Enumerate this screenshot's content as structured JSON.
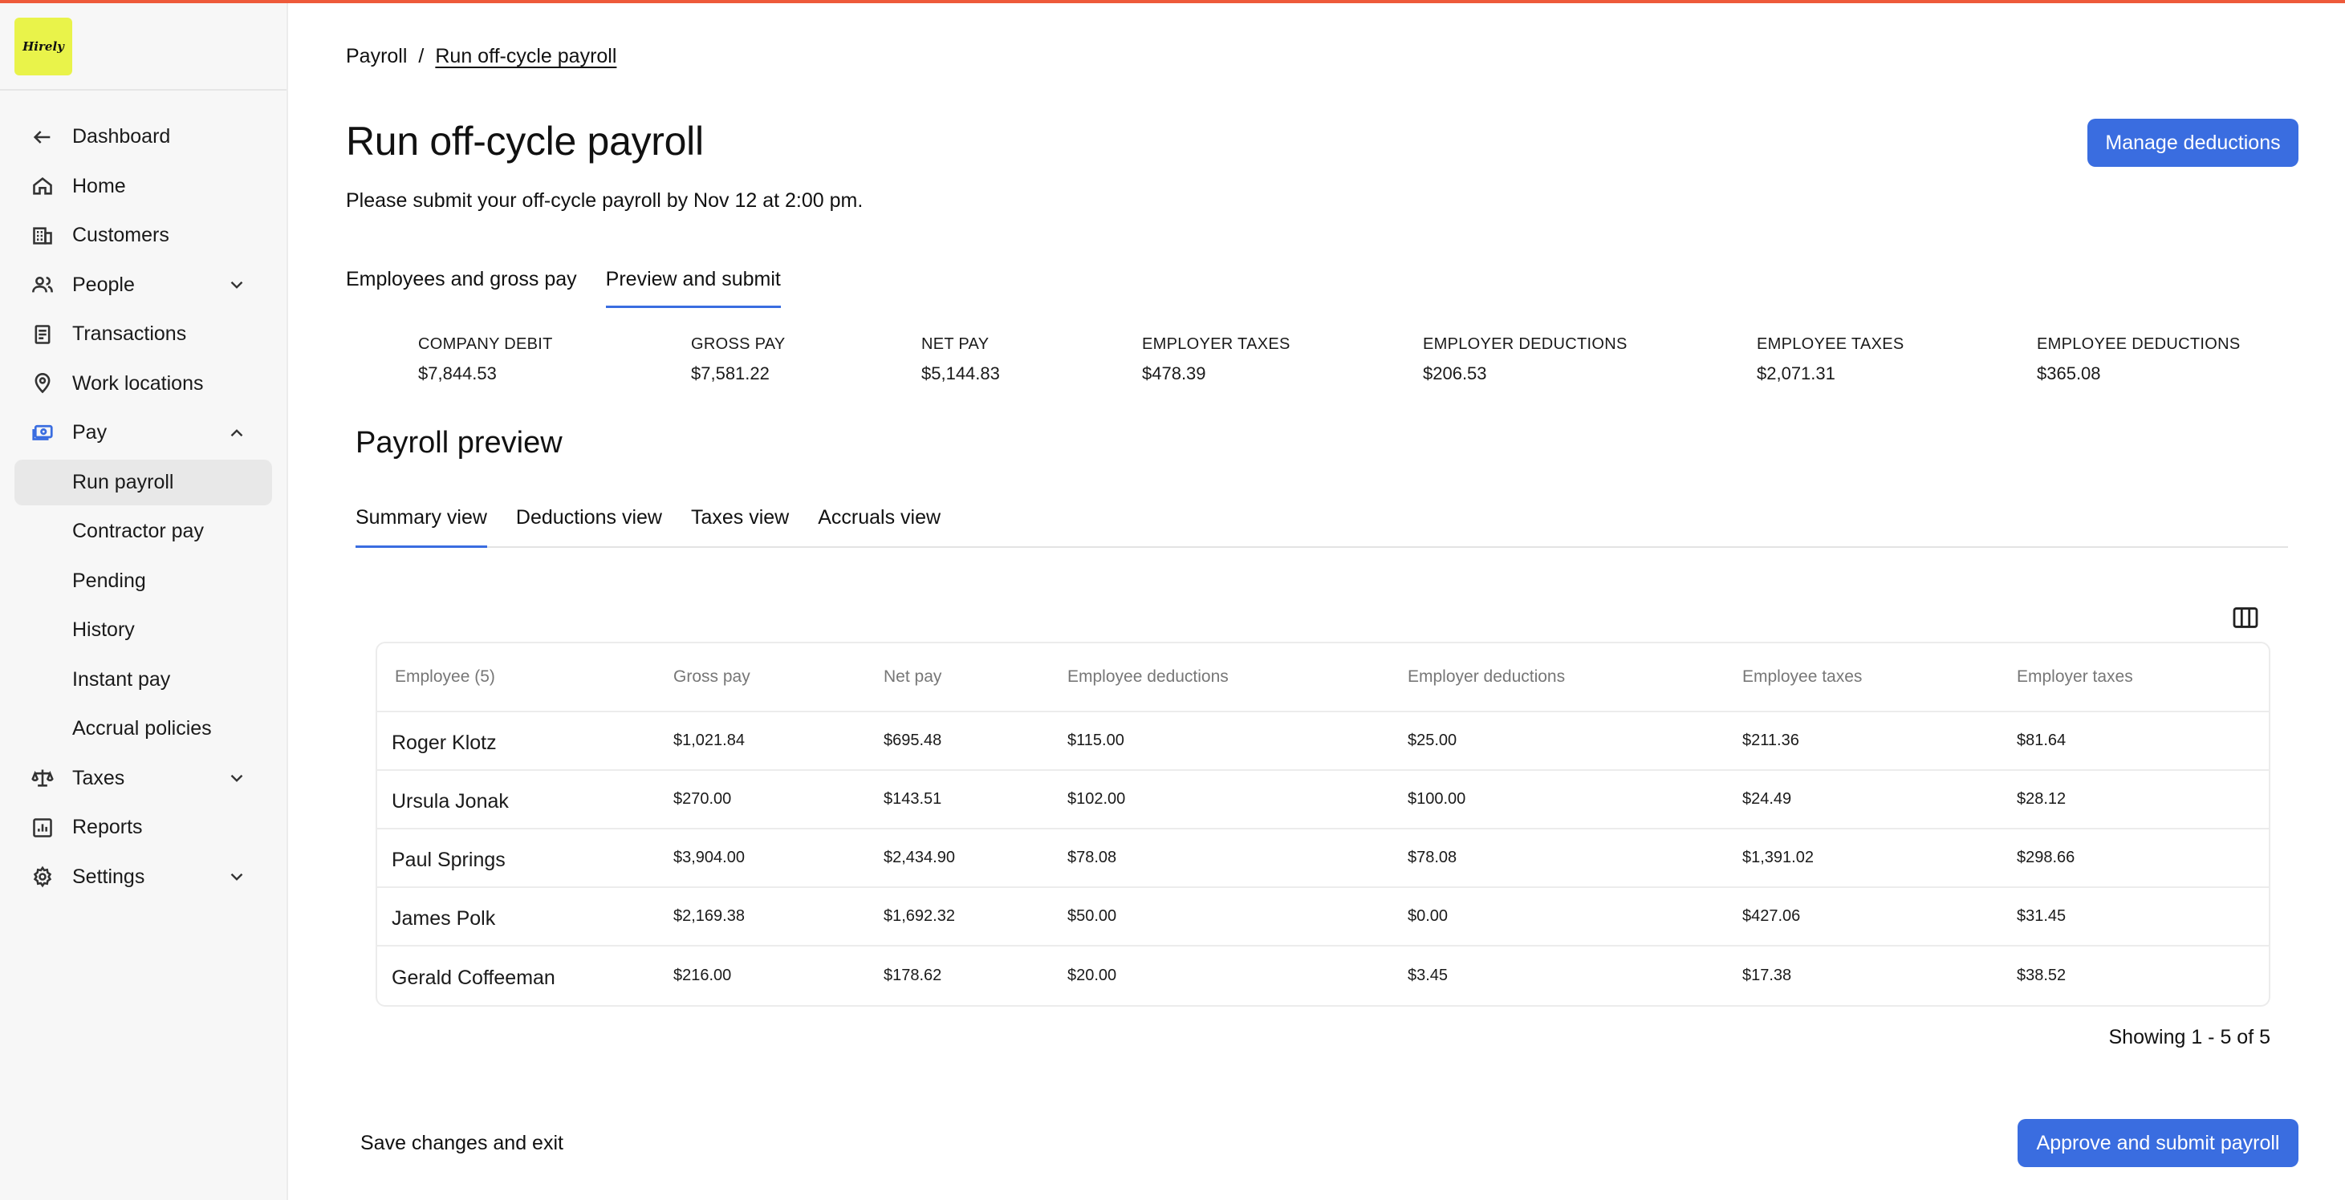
{
  "brand": {
    "logo_text": "Hirely",
    "accent": "#ee5a3a",
    "logo_bg": "#e9f34a",
    "primary": "#3a6de0"
  },
  "sidebar": {
    "items": [
      {
        "label": "Dashboard",
        "icon": "arrow-left-icon"
      },
      {
        "label": "Home",
        "icon": "home-icon"
      },
      {
        "label": "Customers",
        "icon": "building-icon"
      },
      {
        "label": "People",
        "icon": "people-icon",
        "expandable": true
      },
      {
        "label": "Transactions",
        "icon": "receipt-icon"
      },
      {
        "label": "Work locations",
        "icon": "map-pin-icon"
      },
      {
        "label": "Pay",
        "icon": "money-icon",
        "expanded": true
      },
      {
        "label": "Run payroll",
        "sub": true,
        "active": true
      },
      {
        "label": "Contractor pay",
        "sub": true
      },
      {
        "label": "Pending",
        "sub": true
      },
      {
        "label": "History",
        "sub": true
      },
      {
        "label": "Instant pay",
        "sub": true
      },
      {
        "label": "Accrual policies",
        "sub": true
      },
      {
        "label": "Taxes",
        "icon": "scale-icon",
        "expandable": true
      },
      {
        "label": "Reports",
        "icon": "chart-icon"
      },
      {
        "label": "Settings",
        "icon": "gear-icon",
        "expandable": true
      }
    ]
  },
  "breadcrumb": {
    "parent": "Payroll",
    "separator": "/",
    "current": "Run off-cycle payroll"
  },
  "header": {
    "title": "Run off-cycle payroll",
    "subtitle": "Please submit your off-cycle payroll by Nov 12 at 2:00 pm.",
    "manage_button": "Manage deductions"
  },
  "tabs": [
    {
      "label": "Employees and gross pay",
      "active": false
    },
    {
      "label": "Preview and submit",
      "active": true
    }
  ],
  "summary": [
    {
      "label": "COMPANY DEBIT",
      "value": "$7,844.53"
    },
    {
      "label": "GROSS PAY",
      "value": "$7,581.22"
    },
    {
      "label": "NET PAY",
      "value": "$5,144.83"
    },
    {
      "label": "EMPLOYER TAXES",
      "value": "$478.39"
    },
    {
      "label": "EMPLOYER DEDUCTIONS",
      "value": "$206.53"
    },
    {
      "label": "EMPLOYEE TAXES",
      "value": "$2,071.31"
    },
    {
      "label": "EMPLOYEE DEDUCTIONS",
      "value": "$365.08"
    }
  ],
  "preview": {
    "title": "Payroll preview",
    "view_tabs": [
      {
        "label": "Summary view",
        "active": true
      },
      {
        "label": "Deductions view",
        "active": false
      },
      {
        "label": "Taxes view",
        "active": false
      },
      {
        "label": "Accruals view",
        "active": false
      }
    ],
    "columns_icon": "columns-icon"
  },
  "table": {
    "headers": [
      "Employee (5)",
      "Gross pay",
      "Net pay",
      "Employee deductions",
      "Employer deductions",
      "Employee taxes",
      "Employer taxes"
    ],
    "rows": [
      [
        "Roger Klotz",
        "$1,021.84",
        "$695.48",
        "$115.00",
        "$25.00",
        "$211.36",
        "$81.64"
      ],
      [
        "Ursula Jonak",
        "$270.00",
        "$143.51",
        "$102.00",
        "$100.00",
        "$24.49",
        "$28.12"
      ],
      [
        "Paul Springs",
        "$3,904.00",
        "$2,434.90",
        "$78.08",
        "$78.08",
        "$1,391.02",
        "$298.66"
      ],
      [
        "James Polk",
        "$2,169.38",
        "$1,692.32",
        "$50.00",
        "$0.00",
        "$427.06",
        "$31.45"
      ],
      [
        "Gerald Coffeeman",
        "$216.00",
        "$178.62",
        "$20.00",
        "$3.45",
        "$17.38",
        "$38.52"
      ]
    ]
  },
  "pagination": {
    "text": "Showing 1 - 5 of 5"
  },
  "footer": {
    "save_exit": "Save changes and exit",
    "approve": "Approve and submit payroll"
  }
}
